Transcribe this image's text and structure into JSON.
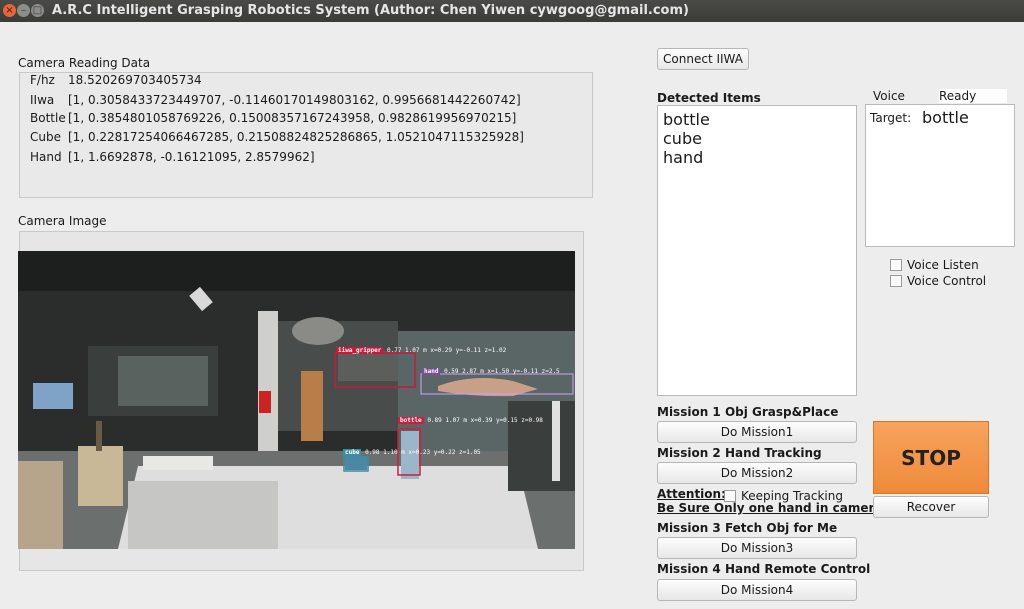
{
  "window": {
    "title": "A.R.C Intelligent Grasping Robotics System (Author: Chen Yiwen cywgoog@gmail.com)"
  },
  "camera_data": {
    "heading": "Camera Reading Data",
    "rows": [
      {
        "key": "F/hz",
        "value": "18.520269703405734"
      },
      {
        "key": "IIwa",
        "value": "[1, 0.3058433723449707, -0.11460170149803162, 0.9956681442260742]"
      },
      {
        "key": "Bottle",
        "value": "[1, 0.3854801058769226, 0.15008357167243958, 0.9828619956970215]"
      },
      {
        "key": "Cube",
        "value": "[1, 0.22817254066467285, 0.21508824825286865, 1.0521047115325928]"
      },
      {
        "key": "Hand",
        "value": "[1, 1.6692878, -0.16121095, 2.8579962]"
      }
    ]
  },
  "camera_image": {
    "heading": "Camera Image",
    "detections": [
      {
        "label": "iiwa_gripper",
        "text": "0.77 1.07 m x=0.29 y=-0.11 z=1.02",
        "color": "#c8193c"
      },
      {
        "label": "hand",
        "text": "0.59 2.87 m x=1.50 y=-0.11 z=2.5",
        "color": "#d0a0ff"
      },
      {
        "label": "bottle",
        "text": "0.89 1.07 m x=0.39 y=0.15 z=0.98",
        "color": "#d01d3d"
      },
      {
        "label": "cube",
        "text": "0.98 1.10 m x=0.23 y=0.22 z=1.05",
        "color": "#3e8e9e"
      }
    ]
  },
  "connect_button": "Connect IIWA",
  "detected": {
    "heading": "Detected Items",
    "items": [
      "bottle",
      "cube",
      "hand"
    ]
  },
  "voice": {
    "label": "Voice",
    "status": "Ready",
    "target_label": "Target:",
    "target_value": "bottle",
    "listen_label": "Voice Listen",
    "control_label": "Voice Control"
  },
  "missions": [
    {
      "heading": "Mission 1 Obj Grasp&Place",
      "button": "Do Mission1"
    },
    {
      "heading": "Mission 2 Hand Tracking",
      "button": "Do Mission2"
    },
    {
      "heading": "Mission 3 Fetch Obj for Me",
      "button": "Do Mission3"
    },
    {
      "heading": "Mission 4 Hand Remote Control",
      "button": "Do Mission4"
    }
  ],
  "attention": {
    "label": "Attention:",
    "checkbox_label": "Keeping Tracking",
    "note": "Be Sure Only one hand  in camera"
  },
  "stop_button": "STOP",
  "recover_button": "Recover",
  "colors": {
    "stop": "#f0903f",
    "titlebar": "#3d3d3a",
    "close": "#e8643a"
  }
}
